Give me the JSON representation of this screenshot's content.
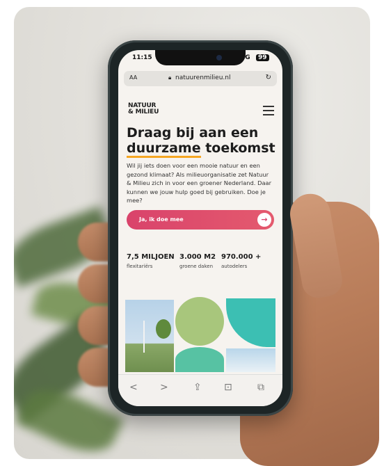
{
  "status_bar": {
    "time": "11:15",
    "signal": "5G",
    "battery": "99"
  },
  "browser": {
    "text_size": "AA",
    "url": "natuurenmilieu.nl"
  },
  "site": {
    "logo_line1": "NATUUR",
    "logo_line2": "& MILIEU",
    "headline_line1": "Draag bij aan een",
    "headline_underlined": "duurzame",
    "headline_rest": " toekomst",
    "intro": "Wil jij iets doen voor een mooie natuur en een gezond klimaat? Als milieuorganisatie zet Natuur & Milieu zich in voor een groener Nederland. Daar kunnen we jouw hulp goed bij gebruiken. Doe je mee?",
    "cta_label": "Ja, ik doe mee",
    "stats": [
      {
        "number": "7,5 MILJOEN",
        "label": "flexitariërs"
      },
      {
        "number": "3.000 M2",
        "label": "groene daken"
      },
      {
        "number": "970.000 +",
        "label": "autodelers"
      }
    ]
  },
  "browser_toolbar": {
    "back": "<",
    "forward": ">",
    "share": "⇪",
    "bookmarks": "⊡",
    "tabs": "⧉"
  },
  "colors": {
    "cta": "#d9436b",
    "accent_underline": "#f5a623",
    "teal": "#3cbfb3"
  }
}
